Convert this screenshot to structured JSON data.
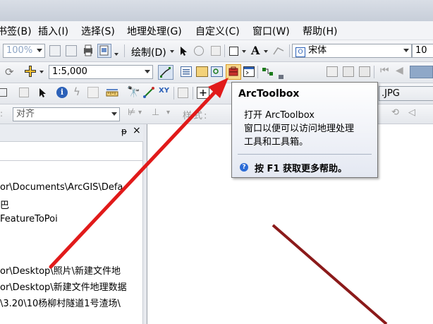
{
  "menubar": {
    "items": [
      {
        "label": "书签(B)"
      },
      {
        "label": "插入(I)"
      },
      {
        "label": "选择(S)"
      },
      {
        "label": "地理处理(G)"
      },
      {
        "label": "自定义(C)"
      },
      {
        "label": "窗口(W)"
      },
      {
        "label": "帮助(H)"
      }
    ]
  },
  "toolbar1": {
    "zoom_value": "100%",
    "draw_label": "绘制(D)",
    "font_name": "宋体",
    "font_size": "10"
  },
  "toolbar2": {
    "scale_value": "1:5,000"
  },
  "toolbar3": {
    "file_label": ".JPG"
  },
  "toolbar4": {
    "snap_label": "对齐",
    "style_label": "样式:"
  },
  "panel": {
    "pin_glyph": "ᵽ",
    "close_glyph": "×",
    "lines": [
      "or\\Documents\\ArcGIS\\Defa",
      "巴",
      "FeatureToPoi",
      "or\\Desktop\\照片\\新建文件地",
      "or\\Desktop\\新建文件地理数据",
      "\\3.20\\10杨柳村隧道1号渣场\\"
    ]
  },
  "tooltip": {
    "title": "ArcToolbox",
    "description": "打开 ArcToolbox\n窗口以便可以访问地理处理\n工具和工具箱。",
    "help_text": "按 F1 获取更多帮助。"
  },
  "colors": {
    "arrow": "#e11a1a",
    "map_line": "#8b1a1a",
    "highlight": "#f3d27a"
  }
}
